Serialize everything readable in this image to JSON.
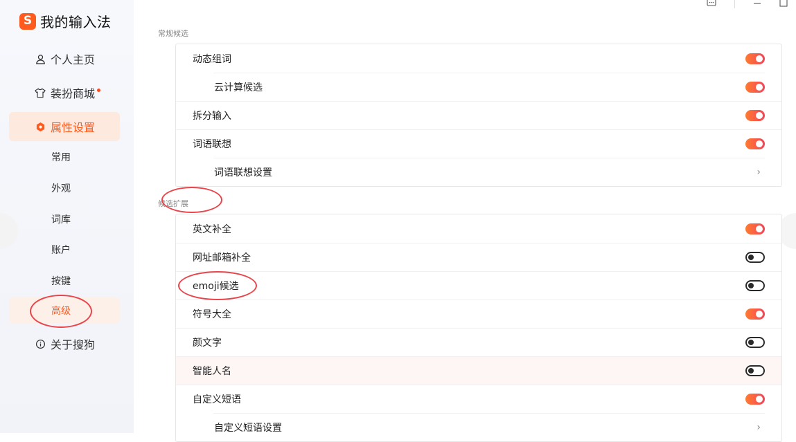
{
  "app": {
    "logo_char": "S",
    "title": "我的输入法"
  },
  "window_controls": [
    "feedback-icon",
    "minimize-icon",
    "maximize-icon"
  ],
  "sidebar": {
    "primary": [
      {
        "label": "个人主页",
        "icon": "user-icon"
      },
      {
        "label": "装扮商城",
        "icon": "tshirt-icon",
        "badge": "red-dot"
      },
      {
        "label": "属性设置",
        "icon": "settings-hex-icon",
        "active": true
      },
      {
        "label": "关于搜狗",
        "icon": "info-icon"
      }
    ],
    "sub": [
      {
        "label": "常用"
      },
      {
        "label": "外观"
      },
      {
        "label": "词库"
      },
      {
        "label": "账户"
      },
      {
        "label": "按键"
      },
      {
        "label": "高级",
        "active": true
      }
    ]
  },
  "sections": [
    {
      "title": "常规候选",
      "rows": [
        {
          "label": "动态组词",
          "control": "toggle",
          "on": true
        },
        {
          "label": "云计算候选",
          "control": "toggle",
          "on": true,
          "indent": true
        },
        {
          "label": "拆分输入",
          "control": "toggle",
          "on": true
        },
        {
          "label": "词语联想",
          "control": "toggle",
          "on": true
        },
        {
          "label": "词语联想设置",
          "control": "chevron",
          "indent": true
        }
      ]
    },
    {
      "title": "候选扩展",
      "rows": [
        {
          "label": "英文补全",
          "control": "toggle",
          "on": true
        },
        {
          "label": "网址邮箱补全",
          "control": "toggle",
          "on": false
        },
        {
          "label": "emoji候选",
          "control": "toggle",
          "on": false
        },
        {
          "label": "符号大全",
          "control": "toggle",
          "on": true
        },
        {
          "label": "颜文字",
          "control": "toggle",
          "on": false
        },
        {
          "label": "智能人名",
          "control": "toggle",
          "on": false
        },
        {
          "label": "自定义短语",
          "control": "toggle",
          "on": true
        },
        {
          "label": "自定义短语设置",
          "control": "chevron",
          "indent": true
        }
      ]
    }
  ],
  "chevron_glyph": "›",
  "colors": {
    "accent": "#ff5b1f",
    "toggle_on_start": "#ff7b30",
    "toggle_on_end": "#f2455a",
    "annotation": "#e8444a"
  }
}
